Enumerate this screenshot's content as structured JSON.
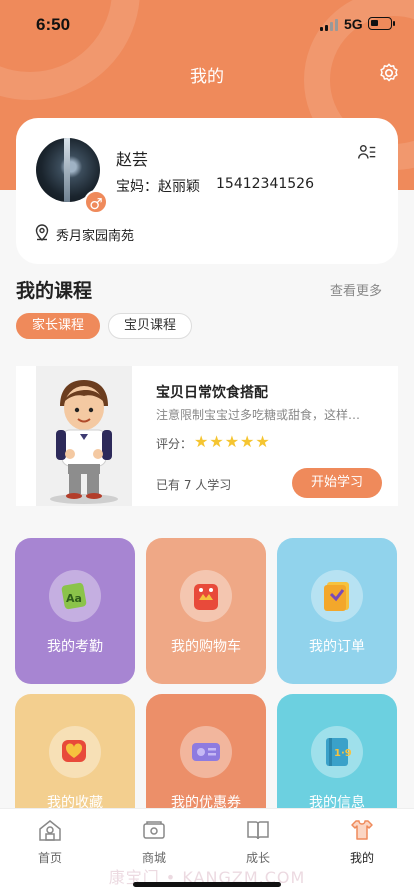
{
  "status": {
    "time": "6:50",
    "network": "5G"
  },
  "header": {
    "title": "我的"
  },
  "profile": {
    "name": "赵芸",
    "mom_label": "宝妈：",
    "mom_name": "赵丽颖",
    "phone": "15412341526",
    "gender": "♂",
    "address": "秀月家园南苑"
  },
  "courses": {
    "title": "我的课程",
    "see_more": "查看更多",
    "tabs": [
      {
        "label": "家长课程",
        "active": true
      },
      {
        "label": "宝贝课程",
        "active": false
      }
    ],
    "items": [
      {
        "title": "宝贝日常饮食搭配",
        "description": "注意限制宝宝过多吃糖或甜食，这样…",
        "rating_label": "评分：",
        "stars": "★★★★★",
        "rating": 5,
        "learners": "已有 7 人学习",
        "start_label": "开始学习"
      }
    ]
  },
  "tiles": [
    {
      "label": "我的考勤",
      "icon": "attendance-icon",
      "color": "#a785d2"
    },
    {
      "label": "我的购物车",
      "icon": "shopping-cart-icon",
      "color": "#efa886"
    },
    {
      "label": "我的订单",
      "icon": "order-icon",
      "color": "#91d3ec"
    },
    {
      "label": "我的收藏",
      "icon": "favorite-icon",
      "color": "#f3cf8f"
    },
    {
      "label": "我的优惠券",
      "icon": "coupon-icon",
      "color": "#ec8f69"
    },
    {
      "label": "我的信息",
      "icon": "message-icon",
      "color": "#6cd0e0"
    }
  ],
  "nav": [
    {
      "label": "首页",
      "icon": "home-icon",
      "active": false
    },
    {
      "label": "商城",
      "icon": "mall-icon",
      "active": false
    },
    {
      "label": "成长",
      "icon": "growth-icon",
      "active": false
    },
    {
      "label": "我的",
      "icon": "profile-icon",
      "active": true
    }
  ],
  "watermark": "康宝门 • KANGZM.COM",
  "colors": {
    "accent": "#ef8a5b",
    "star": "#f5c531"
  }
}
